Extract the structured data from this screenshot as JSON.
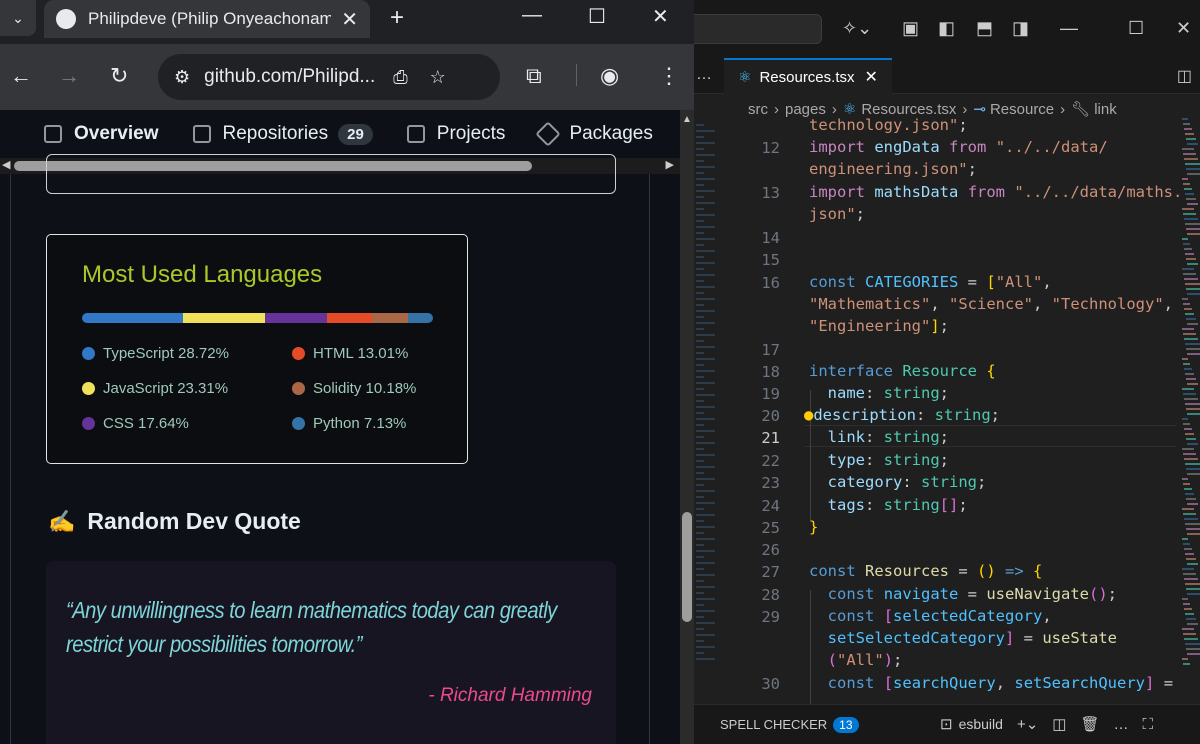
{
  "browser": {
    "tab_title": "Philipdeve (Philip Onyeachonam",
    "new_tab": "+",
    "window_min": "—",
    "window_max": "☐",
    "window_close": "✕",
    "url": "github.com/Philipd...",
    "nav": {
      "overview": "Overview",
      "repositories": "Repositories",
      "repo_count": "29",
      "projects": "Projects",
      "packages": "Packages"
    }
  },
  "languages_card": {
    "title": "Most Used Languages",
    "items": [
      {
        "label": "TypeScript 28.72%",
        "color": "#3178c6",
        "percent": 28.72
      },
      {
        "label": "JavaScript 23.31%",
        "color": "#f1e05a",
        "percent": 23.31
      },
      {
        "label": "CSS 17.64%",
        "color": "#663399",
        "percent": 17.64
      },
      {
        "label": "HTML 13.01%",
        "color": "#e34c26",
        "percent": 13.01
      },
      {
        "label": "Solidity 10.18%",
        "color": "#aa6746",
        "percent": 10.18
      },
      {
        "label": "Python 7.13%",
        "color": "#3572a5",
        "percent": 7.13
      }
    ]
  },
  "quote_section": {
    "emoji": "✍️",
    "heading": "Random Dev Quote",
    "quote": "“Any unwillingness to learn mathematics today can greatly restrict your possibilities tomorrow.”",
    "author": "- Richard Hamming"
  },
  "vscode": {
    "tab_label": "Resources.tsx",
    "breadcrumb": [
      "src",
      "pages",
      "Resources.tsx",
      "Resource",
      "link"
    ],
    "panel": {
      "spell_checker": "SPELL CHECKER",
      "spell_count": "13",
      "terminal": "esbuild"
    }
  }
}
